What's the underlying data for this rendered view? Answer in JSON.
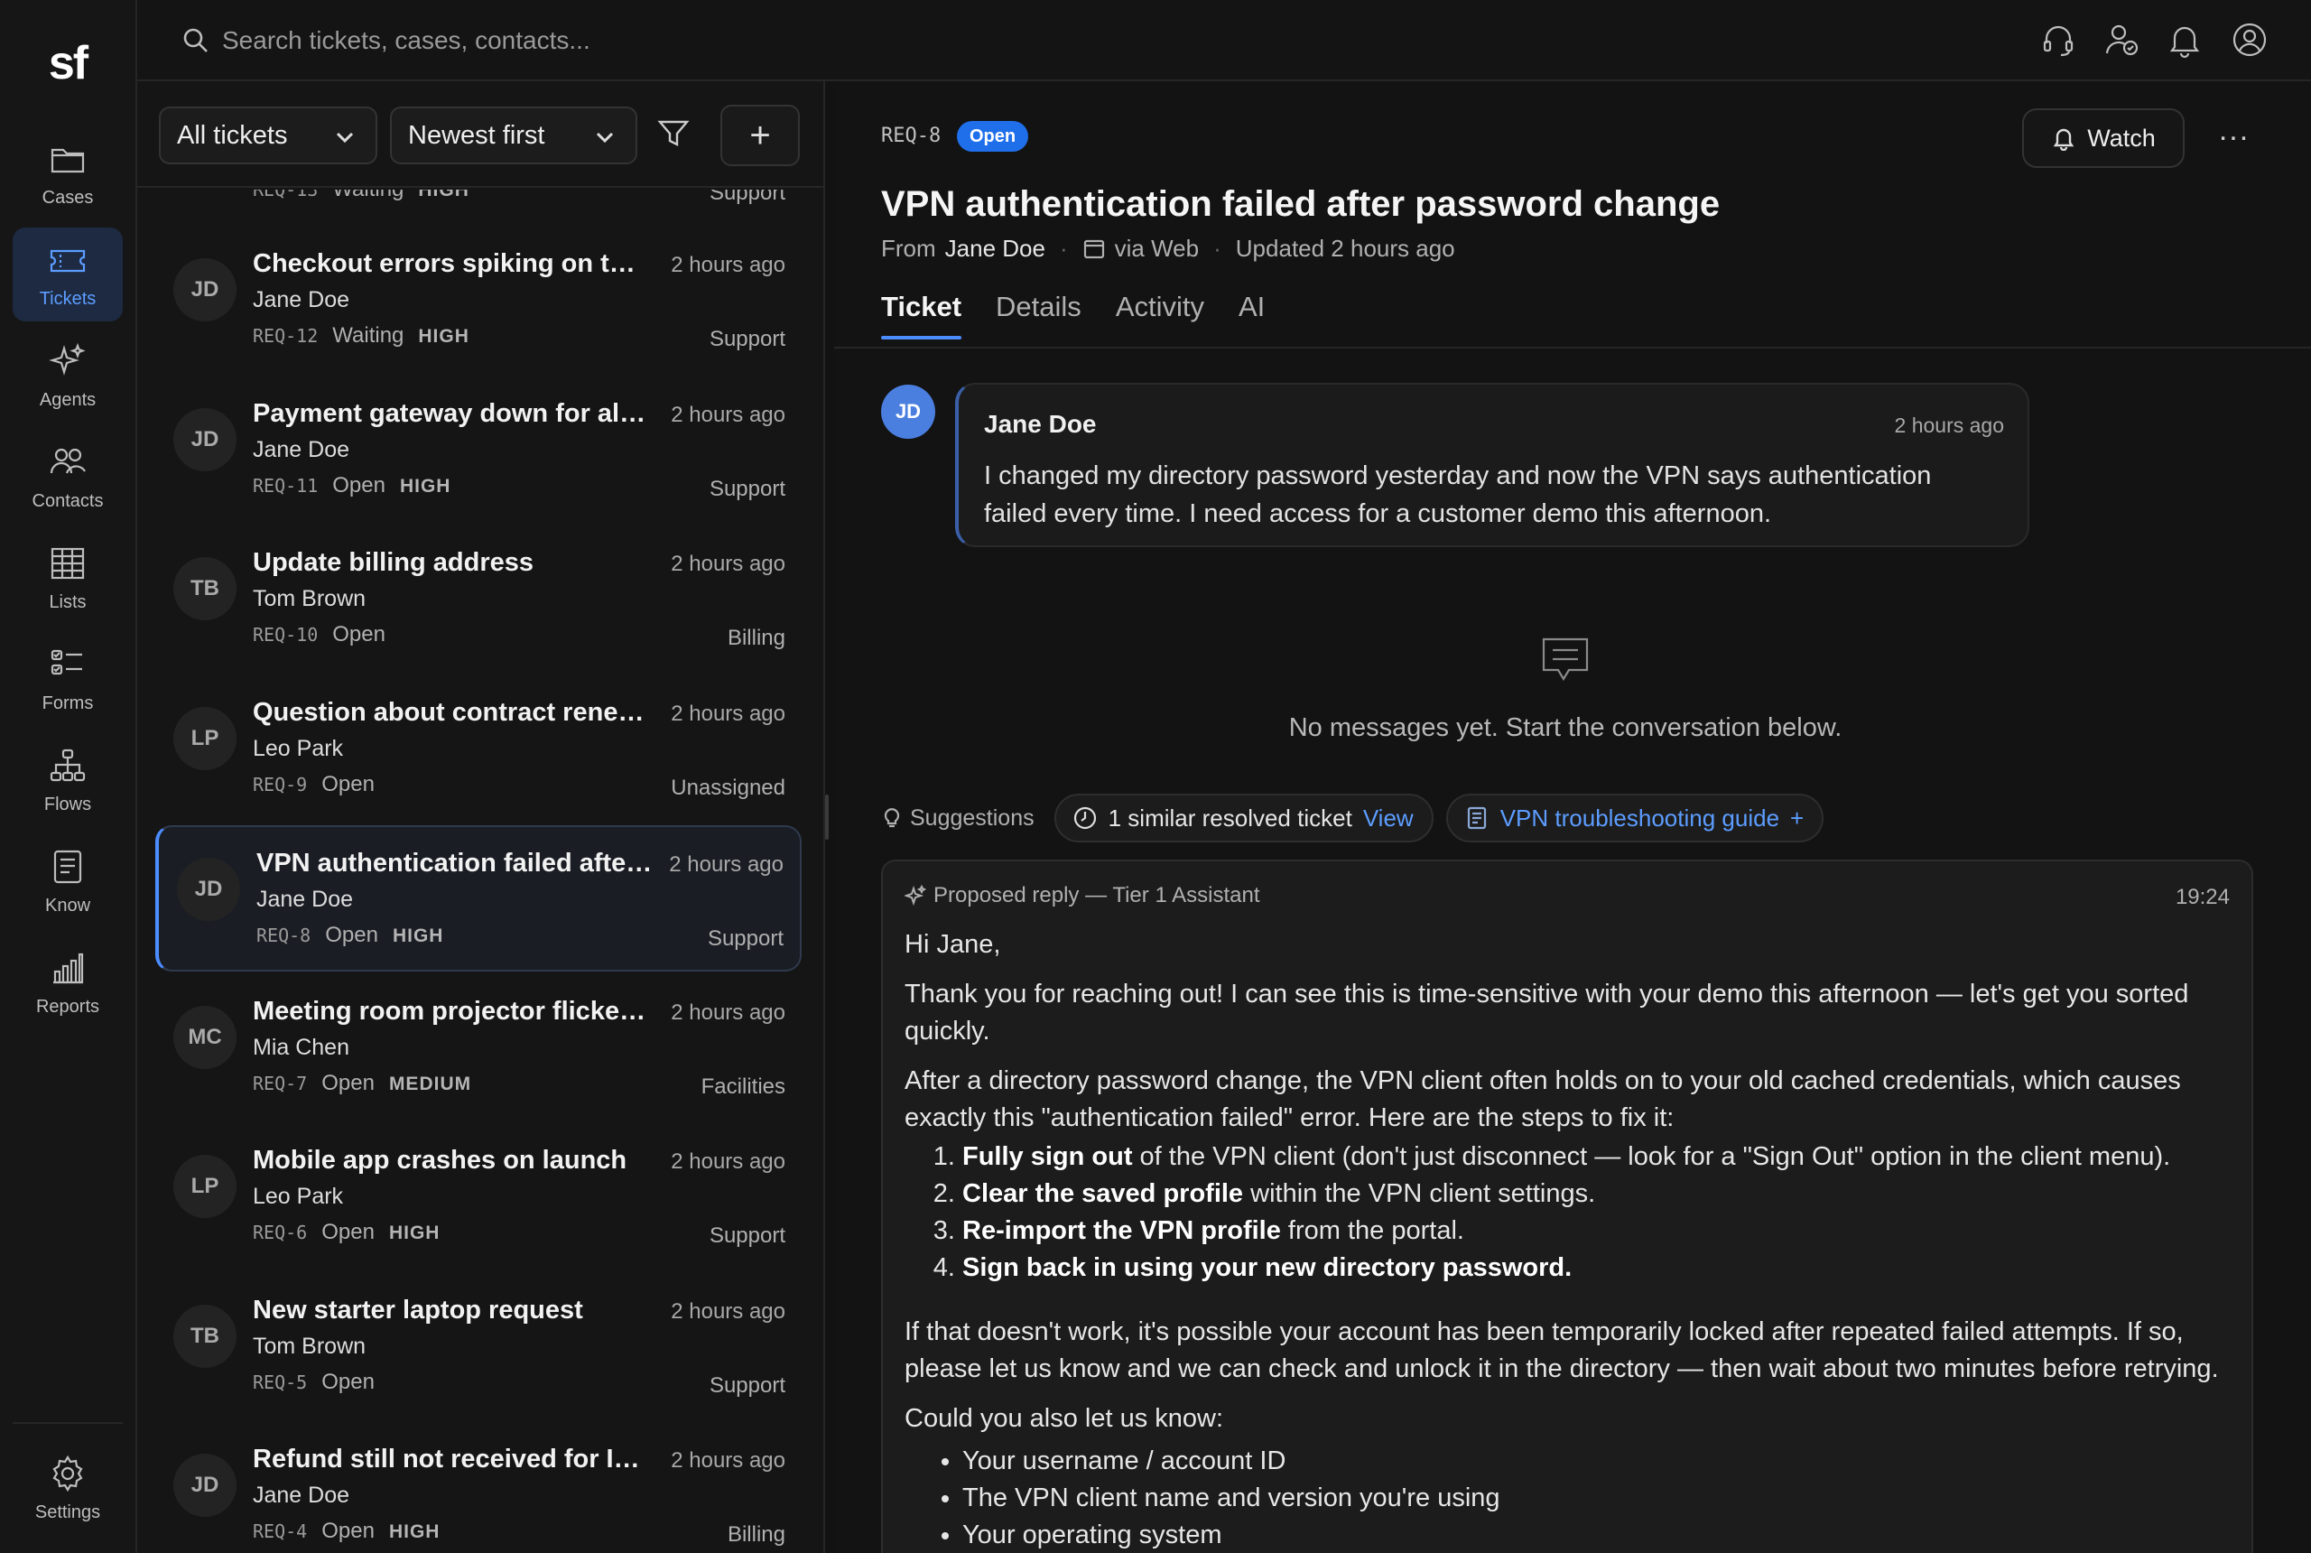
{
  "app": {
    "logo": "sf",
    "nav": [
      {
        "label": "Cases",
        "icon": "folder-icon"
      },
      {
        "label": "Tickets",
        "icon": "ticket-icon"
      },
      {
        "label": "Agents",
        "icon": "sparkle-icon"
      },
      {
        "label": "Contacts",
        "icon": "people-icon"
      },
      {
        "label": "Lists",
        "icon": "table-icon"
      },
      {
        "label": "Forms",
        "icon": "form-icon"
      },
      {
        "label": "Flows",
        "icon": "flow-icon"
      },
      {
        "label": "Know",
        "icon": "document-icon"
      },
      {
        "label": "Reports",
        "icon": "bar-chart-icon"
      }
    ],
    "settings_label": "Settings",
    "active_nav": "Tickets"
  },
  "search": {
    "placeholder": "Search tickets, cases, contacts..."
  },
  "list": {
    "filter_label": "All tickets",
    "sort_label": "Newest first",
    "add_label": "+",
    "partial": {
      "id": "REQ-13",
      "status": "Waiting",
      "priority": "HIGH",
      "dept": "Support"
    },
    "tickets": [
      {
        "initials": "JD",
        "title": "Checkout errors spiking on the E...",
        "time": "2 hours ago",
        "name": "Jane Doe",
        "id": "REQ-12",
        "status": "Waiting",
        "priority": "HIGH",
        "dept": "Support"
      },
      {
        "initials": "JD",
        "title": "Payment gateway down for all c...",
        "time": "2 hours ago",
        "name": "Jane Doe",
        "id": "REQ-11",
        "status": "Open",
        "priority": "HIGH",
        "dept": "Support"
      },
      {
        "initials": "TB",
        "title": "Update billing address",
        "time": "2 hours ago",
        "name": "Tom Brown",
        "id": "REQ-10",
        "status": "Open",
        "priority": "",
        "dept": "Billing"
      },
      {
        "initials": "LP",
        "title": "Question about contract renewa...",
        "time": "2 hours ago",
        "name": "Leo Park",
        "id": "REQ-9",
        "status": "Open",
        "priority": "",
        "dept": "Unassigned"
      },
      {
        "initials": "JD",
        "title": "VPN authentication failed after p...",
        "time": "2 hours ago",
        "name": "Jane Doe",
        "id": "REQ-8",
        "status": "Open",
        "priority": "HIGH",
        "dept": "Support"
      },
      {
        "initials": "MC",
        "title": "Meeting room projector flickering",
        "time": "2 hours ago",
        "name": "Mia Chen",
        "id": "REQ-7",
        "status": "Open",
        "priority": "MEDIUM",
        "dept": "Facilities"
      },
      {
        "initials": "LP",
        "title": "Mobile app crashes on launch",
        "time": "2 hours ago",
        "name": "Leo Park",
        "id": "REQ-6",
        "status": "Open",
        "priority": "HIGH",
        "dept": "Support"
      },
      {
        "initials": "TB",
        "title": "New starter laptop request",
        "time": "2 hours ago",
        "name": "Tom Brown",
        "id": "REQ-5",
        "status": "Open",
        "priority": "",
        "dept": "Support"
      },
      {
        "initials": "JD",
        "title": "Refund still not received for INV-...",
        "time": "2 hours ago",
        "name": "Jane Doe",
        "id": "REQ-4",
        "status": "Open",
        "priority": "HIGH",
        "dept": "Billing"
      }
    ]
  },
  "detail": {
    "id": "REQ-8",
    "status": "Open",
    "watch_label": "Watch",
    "more_label": "...",
    "title": "VPN authentication failed after password change",
    "from_prefix": "From",
    "from_name": "Jane Doe",
    "channel": "via Web",
    "updated": "Updated 2 hours ago",
    "tabs": [
      "Ticket",
      "Details",
      "Activity",
      "AI"
    ],
    "message": {
      "initials": "JD",
      "author": "Jane Doe",
      "time": "2 hours ago",
      "body": "I changed my directory password yesterday and now the VPN says authentication failed every time. I need access for a customer demo this afternoon."
    },
    "empty_text": "No messages yet. Start the conversation below.",
    "suggestions": {
      "label": "Suggestions",
      "similar": "1 similar resolved ticket",
      "view_label": "View",
      "guide": "VPN troubleshooting guide",
      "guide_add": "+"
    },
    "reply": {
      "header": "Proposed reply — Tier 1 Assistant",
      "time": "19:24",
      "greeting": "Hi Jane,",
      "p1": "Thank you for reaching out! I can see this is time-sensitive with your demo this afternoon — let's get you sorted quickly.",
      "p2": "After a directory password change, the VPN client often holds on to your old cached credentials, which causes exactly this \"authentication failed\" error. Here are the steps to fix it:",
      "steps": [
        {
          "bold": "Fully sign out",
          "rest": " of the VPN client (don't just disconnect — look for a \"Sign Out\" option in the client menu)."
        },
        {
          "bold": "Clear the saved profile",
          "rest": " within the VPN client settings."
        },
        {
          "bold": "Re-import the VPN profile",
          "rest": " from the portal."
        },
        {
          "bold": "Sign back in using your new directory password.",
          "rest": ""
        }
      ],
      "p3": "If that doesn't work, it's possible your account has been temporarily locked after repeated failed attempts. If so, please let us know and we can check and unlock it in the directory — then wait about two minutes before retrying.",
      "p4": "Could you also let us know:",
      "bullets": [
        "Your username / account ID",
        "The VPN client name and version you're using",
        "Your operating system"
      ]
    }
  },
  "colors": {
    "accent": "#4b8dff",
    "status_open": "#1f6feb",
    "background": "#121212"
  }
}
